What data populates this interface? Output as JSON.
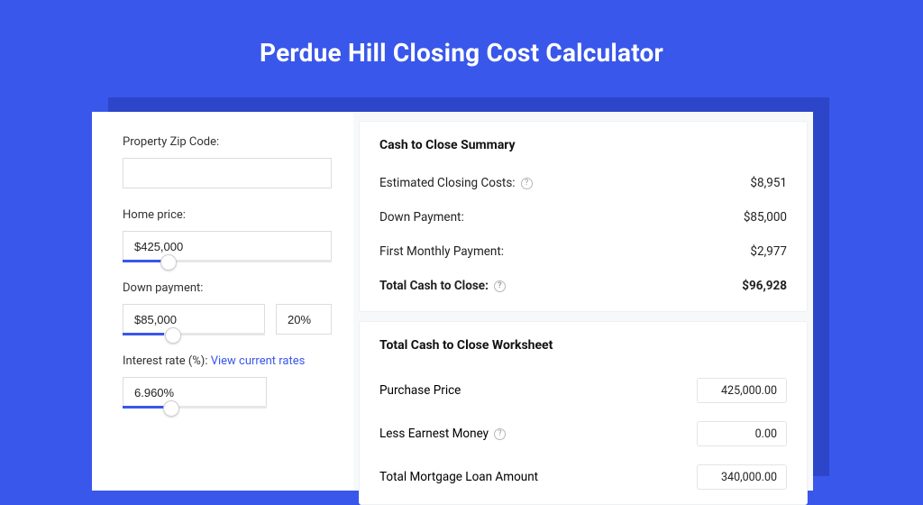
{
  "title": "Perdue Hill Closing Cost Calculator",
  "form": {
    "zip": {
      "label": "Property Zip Code:",
      "value": ""
    },
    "home_price": {
      "label": "Home price:",
      "value": "$425,000",
      "slider_pct": 22
    },
    "down_payment": {
      "label": "Down payment:",
      "value": "$85,000",
      "pct": "20%",
      "slider_pct": 28
    },
    "interest_rate": {
      "label": "Interest rate (%): ",
      "link": "View current rates",
      "value": "6.960%",
      "slider_pct": 34
    }
  },
  "summary": {
    "heading": "Cash to Close Summary",
    "rows": [
      {
        "label": "Estimated Closing Costs:",
        "help": true,
        "value": "$8,951"
      },
      {
        "label": "Down Payment:",
        "help": false,
        "value": "$85,000"
      },
      {
        "label": "First Monthly Payment:",
        "help": false,
        "value": "$2,977"
      }
    ],
    "total": {
      "label": "Total Cash to Close:",
      "help": true,
      "value": "$96,928"
    }
  },
  "worksheet": {
    "heading": "Total Cash to Close Worksheet",
    "rows": [
      {
        "label": "Purchase Price",
        "help": false,
        "value": "425,000.00"
      },
      {
        "label": "Less Earnest Money",
        "help": true,
        "value": "0.00"
      },
      {
        "label": "Total Mortgage Loan Amount",
        "help": false,
        "value": "340,000.00"
      }
    ]
  }
}
